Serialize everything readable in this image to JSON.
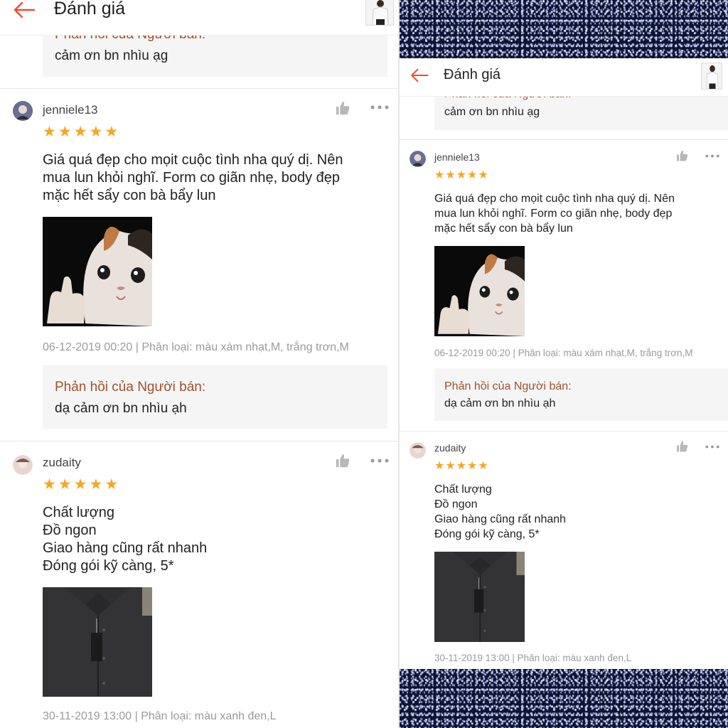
{
  "header": {
    "title": "Đánh giá"
  },
  "colors": {
    "accent": "#ee4d2d",
    "star": "#f6a623",
    "reply_label": "#a0522d",
    "reply_bg": "#f5f5f5"
  },
  "top_reply": {
    "label": "Phản hồi của Người bán:",
    "text": "cảm ơn bn nhìu ạg"
  },
  "reviews": [
    {
      "username": "jenniele13",
      "stars": 5,
      "text_lines": [
        "Giá quá đẹp cho mọit cuộc tình nha quý dị. Nên",
        "mua lun khỏi nghĩ. Form co giãn nhẹ, body đẹp",
        "mặc hết sẩy con bà bẩy lun"
      ],
      "image": "crying-cat-thumbs-up",
      "meta": "06-12-2019 00:20 | Phân loại: màu xám nhạt,M, trắng trơn,M",
      "reply": {
        "label": "Phản hồi của Người bán:",
        "text": "dạ cảm ơn bn nhìu ạh"
      }
    },
    {
      "username": "zudaity",
      "stars": 5,
      "text_lines": [
        "Chất lượng",
        "Đồ ngon",
        "Giao hàng cũng rất nhanh",
        "Đóng gói kỹ càng, 5*"
      ],
      "image": "black-shirt",
      "meta": "30-11-2019 13:00 | Phân loại: màu xanh đen,L"
    }
  ],
  "icons": {
    "back": "back-arrow-icon",
    "like": "thumbs-up-icon",
    "more": "more-icon",
    "star": "star-icon"
  }
}
